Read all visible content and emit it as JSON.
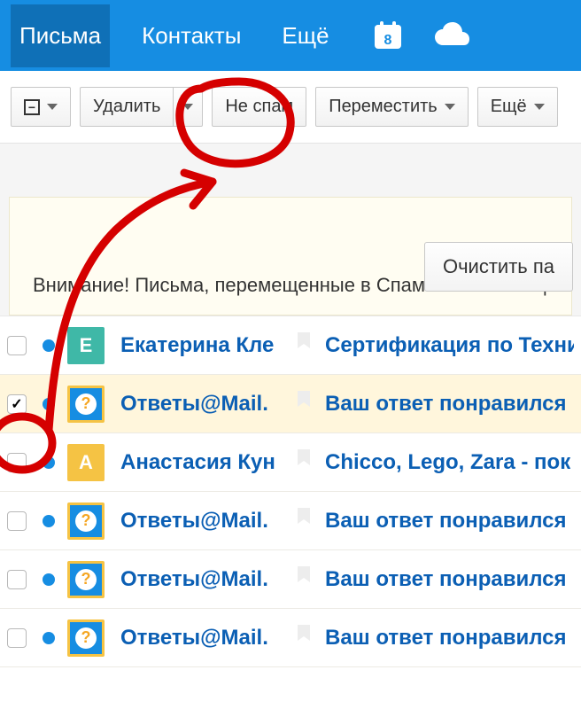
{
  "nav": {
    "mail": "Письма",
    "contacts": "Контакты",
    "more": "Ещё",
    "calendar_day": "8"
  },
  "toolbar": {
    "delete": "Удалить",
    "not_spam": "Не спам",
    "move": "Переместить",
    "more": "Ещё"
  },
  "banner": {
    "clear": "Очистить па",
    "warning": "Внимание! Письма, перемещенные в Спам более месяца"
  },
  "rows": [
    {
      "checked": false,
      "avatar_type": "teal",
      "avatar_letter": "Е",
      "sender": "Екатерина Кле",
      "subject": "Сертификация по Техни"
    },
    {
      "checked": true,
      "avatar_type": "q",
      "avatar_letter": "?",
      "sender": "Ответы@Mail.",
      "subject": "Ваш ответ понравился"
    },
    {
      "checked": false,
      "avatar_type": "yellow",
      "avatar_letter": "А",
      "sender": "Анастасия Кун",
      "subject": "Chicco, Lego, Zara - пок"
    },
    {
      "checked": false,
      "avatar_type": "q",
      "avatar_letter": "?",
      "sender": "Ответы@Mail.",
      "subject": "Ваш ответ понравился"
    },
    {
      "checked": false,
      "avatar_type": "q",
      "avatar_letter": "?",
      "sender": "Ответы@Mail.",
      "subject": "Ваш ответ понравился"
    },
    {
      "checked": false,
      "avatar_type": "q",
      "avatar_letter": "?",
      "sender": "Ответы@Mail.",
      "subject": "Ваш ответ понравился"
    }
  ]
}
